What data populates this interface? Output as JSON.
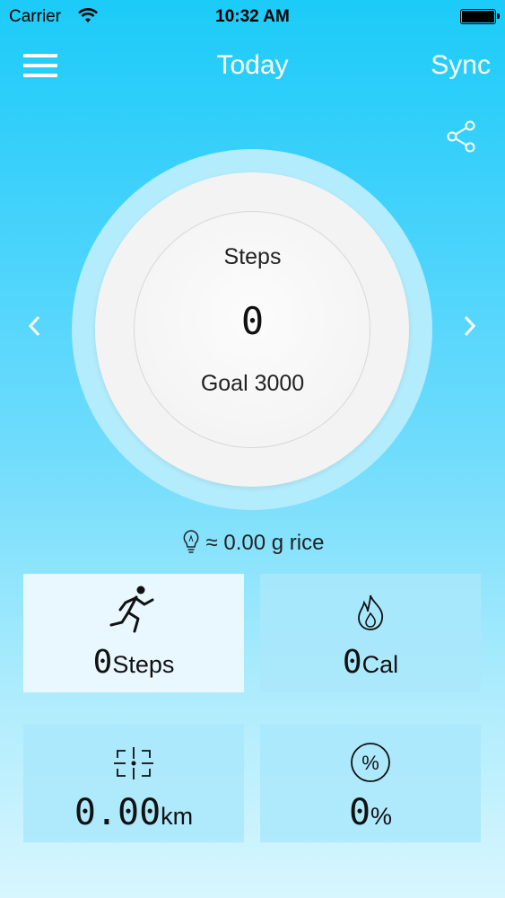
{
  "status_bar": {
    "carrier": "Carrier",
    "time": "10:32 AM"
  },
  "nav": {
    "title": "Today",
    "sync_label": "Sync"
  },
  "ring": {
    "label": "Steps",
    "value": "0",
    "goal": "Goal 3000"
  },
  "rice": {
    "text": "≈ 0.00 g rice"
  },
  "tiles": [
    {
      "icon": "running-person-icon",
      "value": "0",
      "unit": "Steps",
      "selected": true
    },
    {
      "icon": "flame-icon",
      "value": "0",
      "unit": "Cal",
      "selected": false
    },
    {
      "icon": "distance-crosshair-icon",
      "value": "0.00",
      "unit": "km",
      "selected": false
    },
    {
      "icon": "percent-icon",
      "value": "0",
      "unit": "%",
      "selected": false
    }
  ],
  "colors": {
    "background_top": "#1ccbf8",
    "background_bottom": "#d8f6fe",
    "tile": "#aae8fc",
    "tile_selected": "#ecf9fe",
    "text": "#222222"
  }
}
